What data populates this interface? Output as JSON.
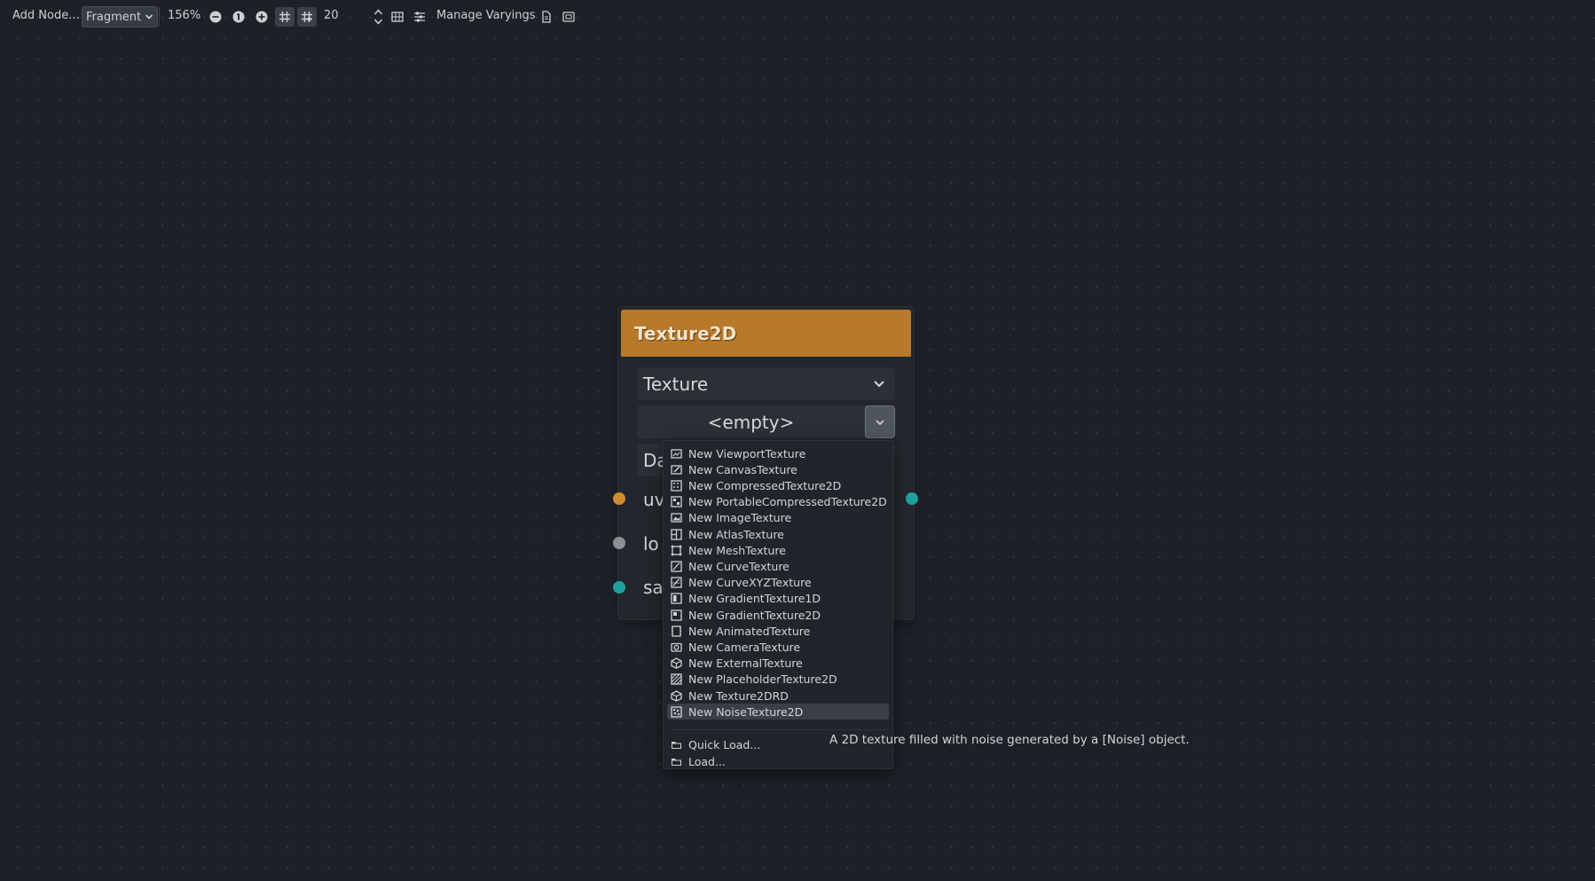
{
  "toolbar": {
    "add_node_label": "Add Node...",
    "mode_value": "Fragment",
    "zoom_label": "156%",
    "grid_step_value": "20",
    "manage_varyings_label": "Manage Varyings"
  },
  "node": {
    "title": "Texture2D",
    "source_select_value": "Texture",
    "texture_value": "<empty>",
    "row3_label_partial": "Da",
    "ports": [
      {
        "label": "uv",
        "color": "#d48a2e"
      },
      {
        "label": "lo",
        "color": "#8c8f94"
      },
      {
        "label": "sa",
        "color": "#20a0a0"
      }
    ],
    "output_port_color": "#20a0a0",
    "header_color": "#b8792a"
  },
  "menu": {
    "items": [
      {
        "label": "New ViewportTexture",
        "icon": "viewport-texture-icon"
      },
      {
        "label": "New CanvasTexture",
        "icon": "canvas-texture-icon"
      },
      {
        "label": "New CompressedTexture2D",
        "icon": "compressed-texture-icon"
      },
      {
        "label": "New PortableCompressedTexture2D",
        "icon": "portable-compressed-texture-icon"
      },
      {
        "label": "New ImageTexture",
        "icon": "image-texture-icon"
      },
      {
        "label": "New AtlasTexture",
        "icon": "atlas-texture-icon"
      },
      {
        "label": "New MeshTexture",
        "icon": "mesh-texture-icon"
      },
      {
        "label": "New CurveTexture",
        "icon": "curve-texture-icon"
      },
      {
        "label": "New CurveXYZTexture",
        "icon": "curve-xyz-texture-icon"
      },
      {
        "label": "New GradientTexture1D",
        "icon": "gradient-texture-1d-icon"
      },
      {
        "label": "New GradientTexture2D",
        "icon": "gradient-texture-2d-icon"
      },
      {
        "label": "New AnimatedTexture",
        "icon": "animated-texture-icon"
      },
      {
        "label": "New CameraTexture",
        "icon": "camera-texture-icon"
      },
      {
        "label": "New ExternalTexture",
        "icon": "external-texture-icon"
      },
      {
        "label": "New PlaceholderTexture2D",
        "icon": "placeholder-texture-icon"
      },
      {
        "label": "New Texture2DRD",
        "icon": "texture2drd-icon"
      },
      {
        "label": "New NoiseTexture2D",
        "icon": "noise-texture-icon"
      }
    ],
    "hovered_index": 16,
    "quick_load_label": "Quick Load...",
    "load_label": "Load..."
  },
  "tooltip": {
    "text": "A 2D texture filled with noise generated by a [Noise] object."
  }
}
